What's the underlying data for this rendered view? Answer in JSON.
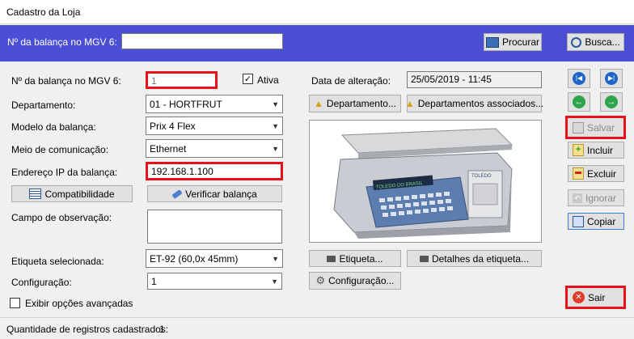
{
  "window": {
    "title": "Cadastro da Loja"
  },
  "topbar": {
    "scale_label": "Nº da balança no MGV 6:",
    "scale_value": "",
    "search_button": "Procurar",
    "find_button": "Busca..."
  },
  "form": {
    "scale_no_label": "Nº da balança no MGV 6:",
    "scale_no_value": "1",
    "active_label": "Ativa",
    "active_checked": true,
    "department_label": "Departamento:",
    "department_value": "01 - HORTFRUT",
    "model_label": "Modelo da balança:",
    "model_value": "Prix 4 Flex",
    "comm_label": "Meio de comunicação:",
    "comm_value": "Ethernet",
    "ip_label": "Endereço IP da balança:",
    "ip_value": "192.168.1.100",
    "compat_button": "Compatibilidade",
    "verify_button": "Verificar balança",
    "obs_label": "Campo de observação:",
    "obs_value": "",
    "label_selected_label": "Etiqueta selecionada:",
    "label_selected_value": "ET-92 (60,0x  45mm)",
    "config_label": "Configuração:",
    "config_value": "1",
    "advanced_label": "Exibir opções avançadas"
  },
  "middle": {
    "changed_label": "Data de alteração:",
    "changed_value": "25/05/2019 - 11:45",
    "departments_button": "Departamento...",
    "assoc_departments_button": "Departamentos associados...",
    "label_button": "Etiqueta...",
    "label_details_button": "Detalhes da etiqueta...",
    "config_button": "Configuração...",
    "scale_display_text": "TOLEDO DO BRASIL",
    "scale_brand_text": "TOLEDO"
  },
  "actions": {
    "save": "Salvar",
    "add": "Incluir",
    "delete": "Excluir",
    "ignore": "Ignorar",
    "copy": "Copiar",
    "exit": "Sair"
  },
  "status": {
    "count_label": "Quantidade de registros cadastrados:",
    "count_value": "1"
  },
  "colors": {
    "topbar": "#4a4fd6",
    "highlight": "#e8101c"
  }
}
